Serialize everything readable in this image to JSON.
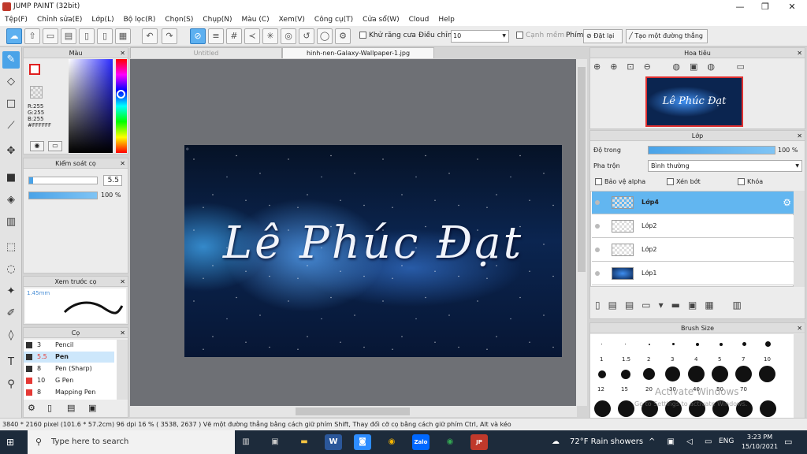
{
  "window": {
    "title": "JUMP PAINT (32bit)",
    "min": "—",
    "max": "❐",
    "close": "✕"
  },
  "menu": [
    "Tệp(F)",
    "Chỉnh sửa(E)",
    "Lớp(L)",
    "Bộ lọc(R)",
    "Chọn(S)",
    "Chụp(N)",
    "Màu (C)",
    "Xem(V)",
    "Công cụ(T)",
    "Cửa sổ(W)",
    "Cloud",
    "Help"
  ],
  "toolbar": {
    "antialias": "Khử răng cưa",
    "adjust_label": "Điều chỉnh",
    "adjust_value": "10",
    "edge": "Cạnh mềm",
    "key_label": "Phím",
    "reset": "Đặt lại",
    "straight": "Tạo một đường thẳng"
  },
  "color_panel": {
    "title": "Màu",
    "rgb_r": "R:255",
    "rgb_g": "G:255",
    "rgb_b": "B:255",
    "hex": "#FFFFFF"
  },
  "brush_control": {
    "title": "Kiểm soát cọ",
    "size": "5.5",
    "opacity": "100 %"
  },
  "preview": {
    "title": "Xem trước cọ",
    "size": "1.45mm"
  },
  "brushes": {
    "title": "Cọ",
    "items": [
      {
        "size": "3",
        "name": "Pencil",
        "color": "#333333"
      },
      {
        "size": "5.5",
        "name": "Pen",
        "color": "#333333"
      },
      {
        "size": "8",
        "name": "Pen (Sharp)",
        "color": "#333333"
      },
      {
        "size": "10",
        "name": "G Pen",
        "color": "#e53935"
      },
      {
        "size": "8",
        "name": "Mapping Pen",
        "color": "#e53935"
      }
    ]
  },
  "tabs": {
    "untitled": "Untitled",
    "file": "hinh-nen-Galaxy-Wallpaper-1.jpg"
  },
  "artwork": {
    "text": "Lê Phúc Đạt"
  },
  "navigator": {
    "title": "Hoa tiêu",
    "thumb_text": "Lê Phúc Đạt"
  },
  "layers": {
    "title": "Lớp",
    "opacity_label": "Độ trong",
    "opacity_value": "100 %",
    "blend_label": "Pha trộn",
    "blend_value": "Bình thường",
    "protect_alpha": "Bảo vệ alpha",
    "clip": "Xén bớt",
    "lock": "Khóa",
    "items": [
      "Lớp4",
      "Lớp2",
      "Lớp2",
      "Lớp1"
    ]
  },
  "brush_size": {
    "title": "Brush Size",
    "row1": [
      "1",
      "1.5",
      "2",
      "3",
      "4",
      "5",
      "7",
      "10"
    ],
    "row2": [
      "12",
      "15",
      "20",
      "30",
      "40",
      "50",
      "70"
    ]
  },
  "watermark": {
    "line1": "Activate Windows",
    "line2": "Go to Settings to activate Windows."
  },
  "status": {
    "text": "3840 * 2160 pixel   (101.6 * 57.2cm)   96 dpi   16 %   ( 3538, 2637 )   Vẽ một đường thẳng bằng cách giữ phím Shift, Thay đổi cỡ cọ bằng cách giữ phím Ctrl, Alt và kéo"
  },
  "taskbar": {
    "search": "Type here to search",
    "weather": "72°F  Rain showers",
    "lang": "ENG",
    "time": "3:23 PM",
    "date": "15/10/2021"
  }
}
